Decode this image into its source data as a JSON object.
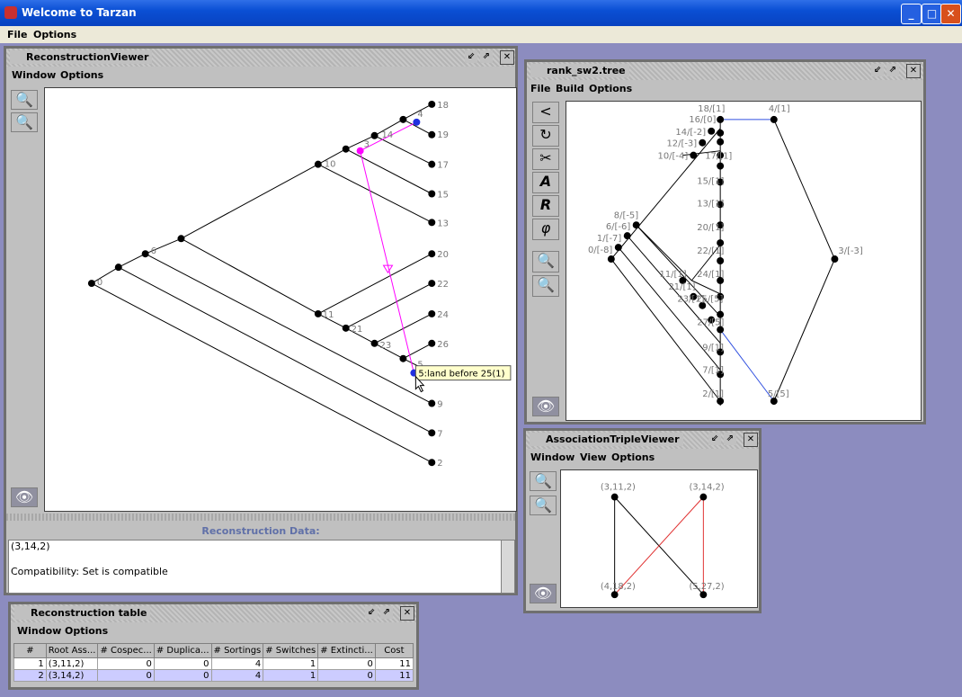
{
  "window": {
    "title": "Welcome to Tarzan",
    "menu": [
      "File",
      "Options"
    ]
  },
  "recon": {
    "title": "ReconstructionViewer",
    "menu": [
      "Window",
      "Options"
    ],
    "panel_label": "Reconstruction Data:",
    "text_lines": [
      "(3,14,2)",
      "Compatibility:  Set is compatible"
    ],
    "tooltip": "5:land before 25(1)",
    "node_labels": [
      "18",
      "4",
      "3",
      "14",
      "19",
      "17",
      "10",
      "15",
      "13",
      "20",
      "22",
      "11",
      "24",
      "21",
      "23",
      "26",
      "5",
      "9",
      "7",
      "2",
      "6",
      "0"
    ]
  },
  "rank": {
    "title": "rank_sw2.tree",
    "menu": [
      "File",
      "Build",
      "Options"
    ],
    "labels": [
      "18/[1]",
      "4/[1]",
      "16/[0]",
      "14/[-2]",
      "12/[-3]",
      "10/[-4]",
      "17/[1]",
      "15/[1]",
      "13/[1]",
      "20/[1]",
      "8/[-5]",
      "6/[-6]",
      "1/[-7]",
      "0/[-8]",
      "22/[1]",
      "3/[-3]",
      "11/[1]",
      "24/[1]",
      "21/[1]",
      "23/[1]",
      "25/[5]",
      "27/[5]",
      "9/[1]",
      "7/[1]",
      "2/[1]",
      "5/[5]"
    ]
  },
  "triple": {
    "title": "AssociationTripleViewer",
    "menu": [
      "Window",
      "View",
      "Options"
    ],
    "labels": [
      "(3,11,2)",
      "(3,14,2)",
      "(4,18,2)",
      "(5,27,2)"
    ]
  },
  "table": {
    "title": "Reconstruction table",
    "menu": [
      "Window",
      "Options"
    ],
    "columns": [
      "#",
      "Root Ass...",
      "# Cospec...",
      "# Duplica...",
      "# Sortings",
      "# Switches",
      "# Extincti...",
      "Cost"
    ],
    "rows": [
      [
        "1",
        "(3,11,2)",
        "0",
        "0",
        "4",
        "1",
        "0",
        "11"
      ],
      [
        "2",
        "(3,14,2)",
        "0",
        "0",
        "4",
        "1",
        "0",
        "11"
      ]
    ]
  },
  "colors": {
    "accent": "#0a4fd4",
    "magenta": "#ff00ff",
    "blue_edge": "#3050e0",
    "red_edge": "#e03030"
  }
}
